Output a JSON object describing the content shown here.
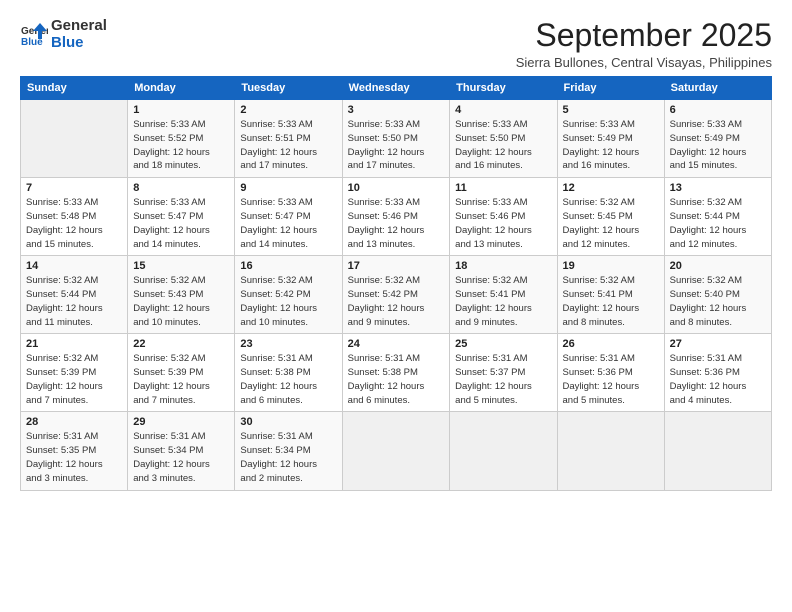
{
  "header": {
    "logo_text_general": "General",
    "logo_text_blue": "Blue",
    "month_title": "September 2025",
    "subtitle": "Sierra Bullones, Central Visayas, Philippines"
  },
  "days_of_week": [
    "Sunday",
    "Monday",
    "Tuesday",
    "Wednesday",
    "Thursday",
    "Friday",
    "Saturday"
  ],
  "weeks": [
    [
      {
        "day": "",
        "info": ""
      },
      {
        "day": "1",
        "info": "Sunrise: 5:33 AM\nSunset: 5:52 PM\nDaylight: 12 hours\nand 18 minutes."
      },
      {
        "day": "2",
        "info": "Sunrise: 5:33 AM\nSunset: 5:51 PM\nDaylight: 12 hours\nand 17 minutes."
      },
      {
        "day": "3",
        "info": "Sunrise: 5:33 AM\nSunset: 5:50 PM\nDaylight: 12 hours\nand 17 minutes."
      },
      {
        "day": "4",
        "info": "Sunrise: 5:33 AM\nSunset: 5:50 PM\nDaylight: 12 hours\nand 16 minutes."
      },
      {
        "day": "5",
        "info": "Sunrise: 5:33 AM\nSunset: 5:49 PM\nDaylight: 12 hours\nand 16 minutes."
      },
      {
        "day": "6",
        "info": "Sunrise: 5:33 AM\nSunset: 5:49 PM\nDaylight: 12 hours\nand 15 minutes."
      }
    ],
    [
      {
        "day": "7",
        "info": "Sunrise: 5:33 AM\nSunset: 5:48 PM\nDaylight: 12 hours\nand 15 minutes."
      },
      {
        "day": "8",
        "info": "Sunrise: 5:33 AM\nSunset: 5:47 PM\nDaylight: 12 hours\nand 14 minutes."
      },
      {
        "day": "9",
        "info": "Sunrise: 5:33 AM\nSunset: 5:47 PM\nDaylight: 12 hours\nand 14 minutes."
      },
      {
        "day": "10",
        "info": "Sunrise: 5:33 AM\nSunset: 5:46 PM\nDaylight: 12 hours\nand 13 minutes."
      },
      {
        "day": "11",
        "info": "Sunrise: 5:33 AM\nSunset: 5:46 PM\nDaylight: 12 hours\nand 13 minutes."
      },
      {
        "day": "12",
        "info": "Sunrise: 5:32 AM\nSunset: 5:45 PM\nDaylight: 12 hours\nand 12 minutes."
      },
      {
        "day": "13",
        "info": "Sunrise: 5:32 AM\nSunset: 5:44 PM\nDaylight: 12 hours\nand 12 minutes."
      }
    ],
    [
      {
        "day": "14",
        "info": "Sunrise: 5:32 AM\nSunset: 5:44 PM\nDaylight: 12 hours\nand 11 minutes."
      },
      {
        "day": "15",
        "info": "Sunrise: 5:32 AM\nSunset: 5:43 PM\nDaylight: 12 hours\nand 10 minutes."
      },
      {
        "day": "16",
        "info": "Sunrise: 5:32 AM\nSunset: 5:42 PM\nDaylight: 12 hours\nand 10 minutes."
      },
      {
        "day": "17",
        "info": "Sunrise: 5:32 AM\nSunset: 5:42 PM\nDaylight: 12 hours\nand 9 minutes."
      },
      {
        "day": "18",
        "info": "Sunrise: 5:32 AM\nSunset: 5:41 PM\nDaylight: 12 hours\nand 9 minutes."
      },
      {
        "day": "19",
        "info": "Sunrise: 5:32 AM\nSunset: 5:41 PM\nDaylight: 12 hours\nand 8 minutes."
      },
      {
        "day": "20",
        "info": "Sunrise: 5:32 AM\nSunset: 5:40 PM\nDaylight: 12 hours\nand 8 minutes."
      }
    ],
    [
      {
        "day": "21",
        "info": "Sunrise: 5:32 AM\nSunset: 5:39 PM\nDaylight: 12 hours\nand 7 minutes."
      },
      {
        "day": "22",
        "info": "Sunrise: 5:32 AM\nSunset: 5:39 PM\nDaylight: 12 hours\nand 7 minutes."
      },
      {
        "day": "23",
        "info": "Sunrise: 5:31 AM\nSunset: 5:38 PM\nDaylight: 12 hours\nand 6 minutes."
      },
      {
        "day": "24",
        "info": "Sunrise: 5:31 AM\nSunset: 5:38 PM\nDaylight: 12 hours\nand 6 minutes."
      },
      {
        "day": "25",
        "info": "Sunrise: 5:31 AM\nSunset: 5:37 PM\nDaylight: 12 hours\nand 5 minutes."
      },
      {
        "day": "26",
        "info": "Sunrise: 5:31 AM\nSunset: 5:36 PM\nDaylight: 12 hours\nand 5 minutes."
      },
      {
        "day": "27",
        "info": "Sunrise: 5:31 AM\nSunset: 5:36 PM\nDaylight: 12 hours\nand 4 minutes."
      }
    ],
    [
      {
        "day": "28",
        "info": "Sunrise: 5:31 AM\nSunset: 5:35 PM\nDaylight: 12 hours\nand 3 minutes."
      },
      {
        "day": "29",
        "info": "Sunrise: 5:31 AM\nSunset: 5:34 PM\nDaylight: 12 hours\nand 3 minutes."
      },
      {
        "day": "30",
        "info": "Sunrise: 5:31 AM\nSunset: 5:34 PM\nDaylight: 12 hours\nand 2 minutes."
      },
      {
        "day": "",
        "info": ""
      },
      {
        "day": "",
        "info": ""
      },
      {
        "day": "",
        "info": ""
      },
      {
        "day": "",
        "info": ""
      }
    ]
  ]
}
